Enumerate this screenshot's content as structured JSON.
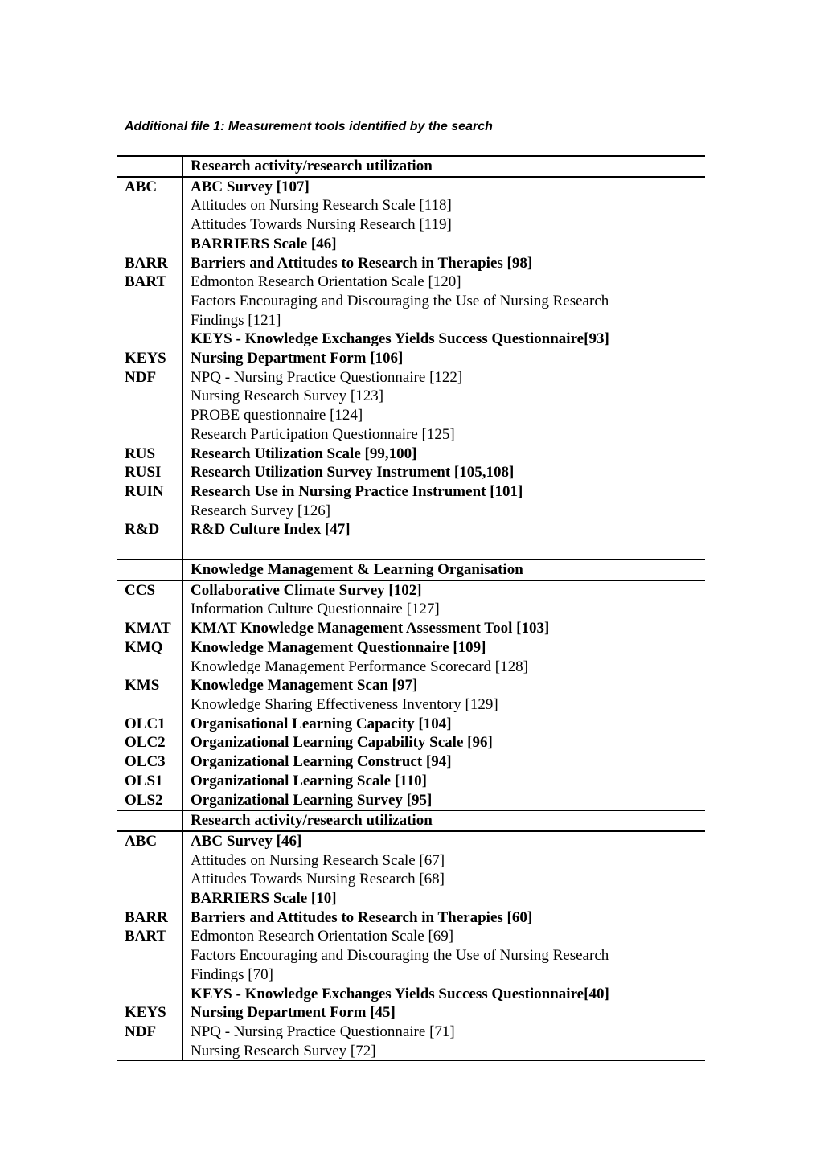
{
  "document": {
    "title": "Additional file 1: Measurement tools identified by the search",
    "sections": [
      {
        "heading": "Research activity/research utilization",
        "rows": [
          {
            "abbr": "ABC",
            "name": "ABC Survey [107]",
            "bold": true
          },
          {
            "abbr": "",
            "name": "Attitudes on Nursing Research Scale [118]",
            "bold": false
          },
          {
            "abbr": "",
            "name": "Attitudes Towards Nursing Research [119]",
            "bold": false
          },
          {
            "abbr": "",
            "name": "BARRIERS Scale [46]",
            "bold": true
          },
          {
            "abbr": "BARR",
            "name": "Barriers and Attitudes to Research in Therapies [98]",
            "bold": true
          },
          {
            "abbr": "BART",
            "name": "Edmonton Research Orientation Scale [120]",
            "bold": false
          },
          {
            "abbr": "",
            "name": "Factors Encouraging and Discouraging the Use of Nursing Research",
            "bold": false,
            "justify": true
          },
          {
            "abbr": "",
            "name": "Findings [121]",
            "bold": false
          },
          {
            "abbr": "",
            "name": "KEYS - Knowledge Exchanges Yields Success Questionnaire[93]",
            "bold": true
          },
          {
            "abbr": "KEYS",
            "name": "Nursing Department Form [106]",
            "bold": true
          },
          {
            "abbr": "NDF",
            "name": "NPQ - Nursing Practice Questionnaire [122]",
            "bold": false
          },
          {
            "abbr": "",
            "name": "Nursing Research Survey [123]",
            "bold": false
          },
          {
            "abbr": "",
            "name": "PROBE questionnaire [124]",
            "bold": false
          },
          {
            "abbr": "",
            "name": "Research Participation Questionnaire [125]",
            "bold": false
          },
          {
            "abbr": "RUS",
            "name": "Research Utilization Scale [99,100]",
            "bold": true
          },
          {
            "abbr": "RUSI",
            "name": "Research Utilization Survey Instrument [105,108]",
            "bold": true
          },
          {
            "abbr": "RUIN",
            "name": "Research Use in Nursing Practice Instrument [101]",
            "bold": true
          },
          {
            "abbr": "",
            "name": "Research Survey [126]",
            "bold": false
          },
          {
            "abbr": "R&D",
            "name": "R&D Culture Index [47]",
            "bold": true
          }
        ]
      },
      {
        "heading": "Knowledge Management & Learning Organisation",
        "rows": [
          {
            "abbr": "CCS",
            "name": "Collaborative Climate Survey [102]",
            "bold": true
          },
          {
            "abbr": "",
            "name": "Information Culture Questionnaire [127]",
            "bold": false
          },
          {
            "abbr": "KMAT",
            "name": "KMAT Knowledge Management Assessment Tool [103]",
            "bold": true
          },
          {
            "abbr": "KMQ",
            "name": "Knowledge Management Questionnaire [109]",
            "bold": true
          },
          {
            "abbr": "",
            "name": "Knowledge Management Performance Scorecard [128]",
            "bold": false
          },
          {
            "abbr": "KMS",
            "name": "Knowledge Management Scan [97]",
            "bold": true
          },
          {
            "abbr": "",
            "name": "Knowledge Sharing Effectiveness Inventory [129]",
            "bold": false
          },
          {
            "abbr": "OLC1",
            "name": "Organisational Learning Capacity [104]",
            "bold": true
          },
          {
            "abbr": "OLC2",
            "name": "Organizational Learning Capability Scale [96]",
            "bold": true
          },
          {
            "abbr": "OLC3",
            "name": "Organizational Learning Construct [94]",
            "bold": true
          },
          {
            "abbr": "OLS1",
            "name": "Organizational Learning Scale [110]",
            "bold": true
          },
          {
            "abbr": "OLS2",
            "name": "Organizational Learning Survey [95]",
            "bold": true
          }
        ]
      },
      {
        "heading": "Research activity/research utilization",
        "rows": [
          {
            "abbr": "ABC",
            "name": "ABC Survey [46]",
            "bold": true
          },
          {
            "abbr": "",
            "name": "Attitudes on Nursing Research Scale [67]",
            "bold": false
          },
          {
            "abbr": "",
            "name": "Attitudes Towards Nursing Research [68]",
            "bold": false
          },
          {
            "abbr": "",
            "name": "BARRIERS Scale [10]",
            "bold": true
          },
          {
            "abbr": "BARR",
            "name": "Barriers and Attitudes to Research in Therapies [60]",
            "bold": true
          },
          {
            "abbr": "BART",
            "name": "Edmonton Research Orientation Scale [69]",
            "bold": false
          },
          {
            "abbr": "",
            "name": "Factors Encouraging and Discouraging the Use of Nursing Research",
            "bold": false,
            "justify": true
          },
          {
            "abbr": "",
            "name": "Findings [70]",
            "bold": false
          },
          {
            "abbr": "",
            "name": "KEYS - Knowledge Exchanges Yields Success Questionnaire[40]",
            "bold": true
          },
          {
            "abbr": "KEYS",
            "name": "Nursing Department Form [45]",
            "bold": true
          },
          {
            "abbr": "NDF",
            "name": "NPQ - Nursing Practice Questionnaire [71]",
            "bold": false
          },
          {
            "abbr": "",
            "name": "Nursing Research Survey [72]",
            "bold": false
          }
        ]
      }
    ]
  }
}
